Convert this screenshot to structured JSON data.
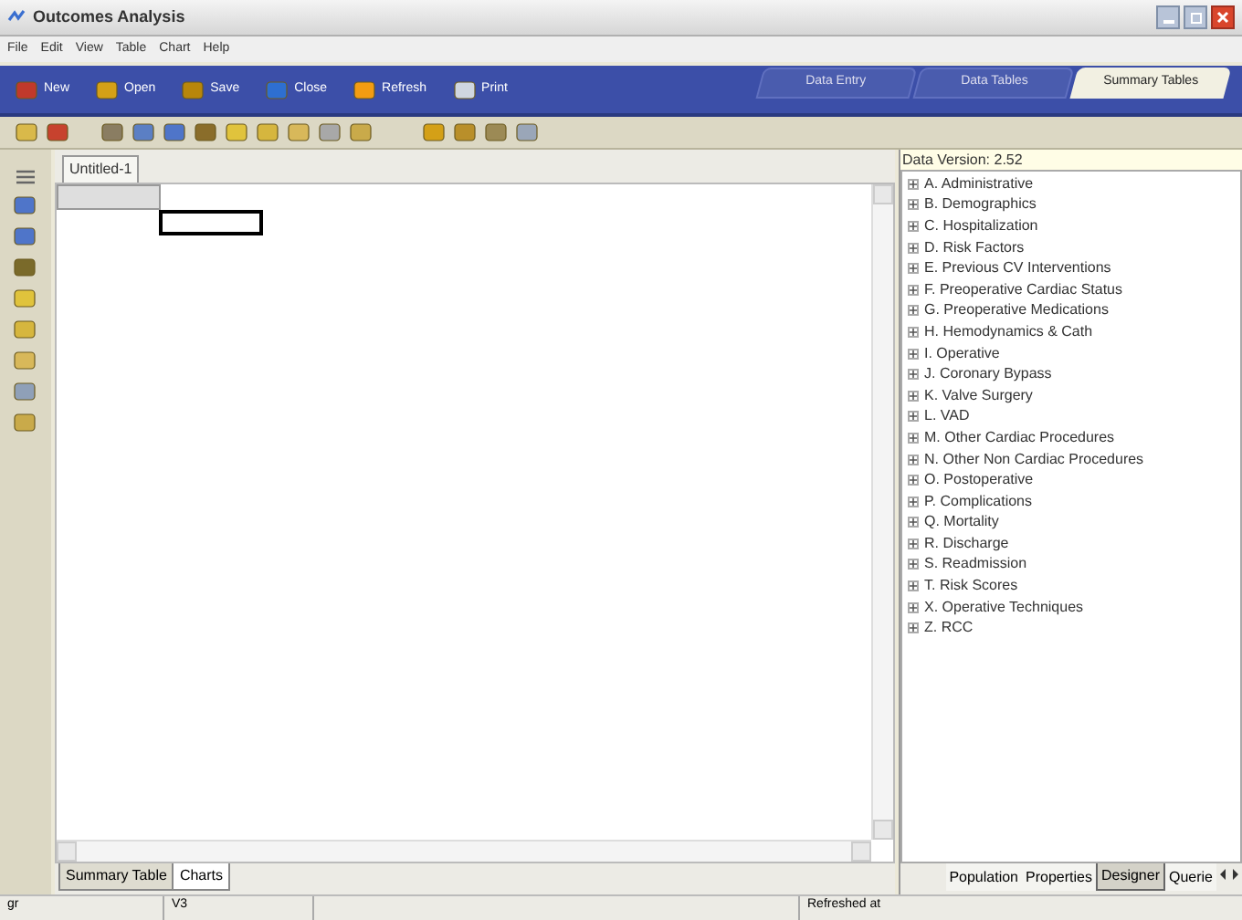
{
  "window": {
    "title": "Outcomes Analysis"
  },
  "menu": [
    "File",
    "Edit",
    "View",
    "Table",
    "Chart",
    "Help"
  ],
  "toolbar": [
    {
      "label": "New",
      "kind": "new"
    },
    {
      "label": "Open",
      "kind": "open"
    },
    {
      "label": "Save",
      "kind": "save"
    },
    {
      "label": "Close",
      "kind": "close"
    },
    {
      "label": "Refresh",
      "kind": "refresh"
    },
    {
      "label": "Print",
      "kind": "print"
    }
  ],
  "module_tabs": [
    {
      "label": "Data Entry",
      "selected": false
    },
    {
      "label": "Data Tables",
      "selected": false
    },
    {
      "label": "Summary Tables",
      "selected": true
    }
  ],
  "document_tab": "Untitled-1",
  "data_version": "Data Version: 2.52",
  "tree": [
    {
      "label": "A. Administrative",
      "expanded": false
    },
    {
      "label": "B. Demographics",
      "expanded": false
    },
    {
      "label": "C. Hospitalization",
      "expanded": false
    },
    {
      "label": "D. Risk Factors",
      "expanded": false
    },
    {
      "label": "E. Previous CV Interventions",
      "expanded": false
    },
    {
      "label": "F. Preoperative Cardiac Status",
      "expanded": false
    },
    {
      "label": "G. Preoperative Medications",
      "expanded": false
    },
    {
      "label": "H. Hemodynamics & Cath",
      "expanded": false
    },
    {
      "label": "I. Operative",
      "expanded": false
    },
    {
      "label": "J. Coronary Bypass",
      "expanded": false
    },
    {
      "label": "K. Valve Surgery",
      "expanded": false
    },
    {
      "label": "L. VAD",
      "expanded": false
    },
    {
      "label": "M. Other Cardiac Procedures",
      "expanded": false
    },
    {
      "label": "N. Other Non Cardiac Procedures",
      "expanded": false
    },
    {
      "label": "O. Postoperative",
      "expanded": false
    },
    {
      "label": "P. Complications",
      "expanded": false
    },
    {
      "label": "Q. Mortality",
      "expanded": false
    },
    {
      "label": "R. Discharge",
      "expanded": false
    },
    {
      "label": "S. Readmission",
      "expanded": false
    },
    {
      "label": "T. Risk Scores",
      "expanded": false
    },
    {
      "label": "X. Operative Techniques",
      "expanded": false
    },
    {
      "label": "Z. RCC",
      "expanded": false
    }
  ],
  "bottom_tabs": [
    {
      "label": "Summary Table",
      "selected": false
    },
    {
      "label": "Charts",
      "selected": true
    }
  ],
  "panel_tabs": [
    {
      "label": "Population",
      "selected": false
    },
    {
      "label": "Properties",
      "selected": false
    },
    {
      "label": "Designer",
      "selected": true
    },
    {
      "label": "Querie",
      "selected": false
    }
  ],
  "status_bar": [
    "gr",
    "V3",
    "Refreshed at"
  ]
}
